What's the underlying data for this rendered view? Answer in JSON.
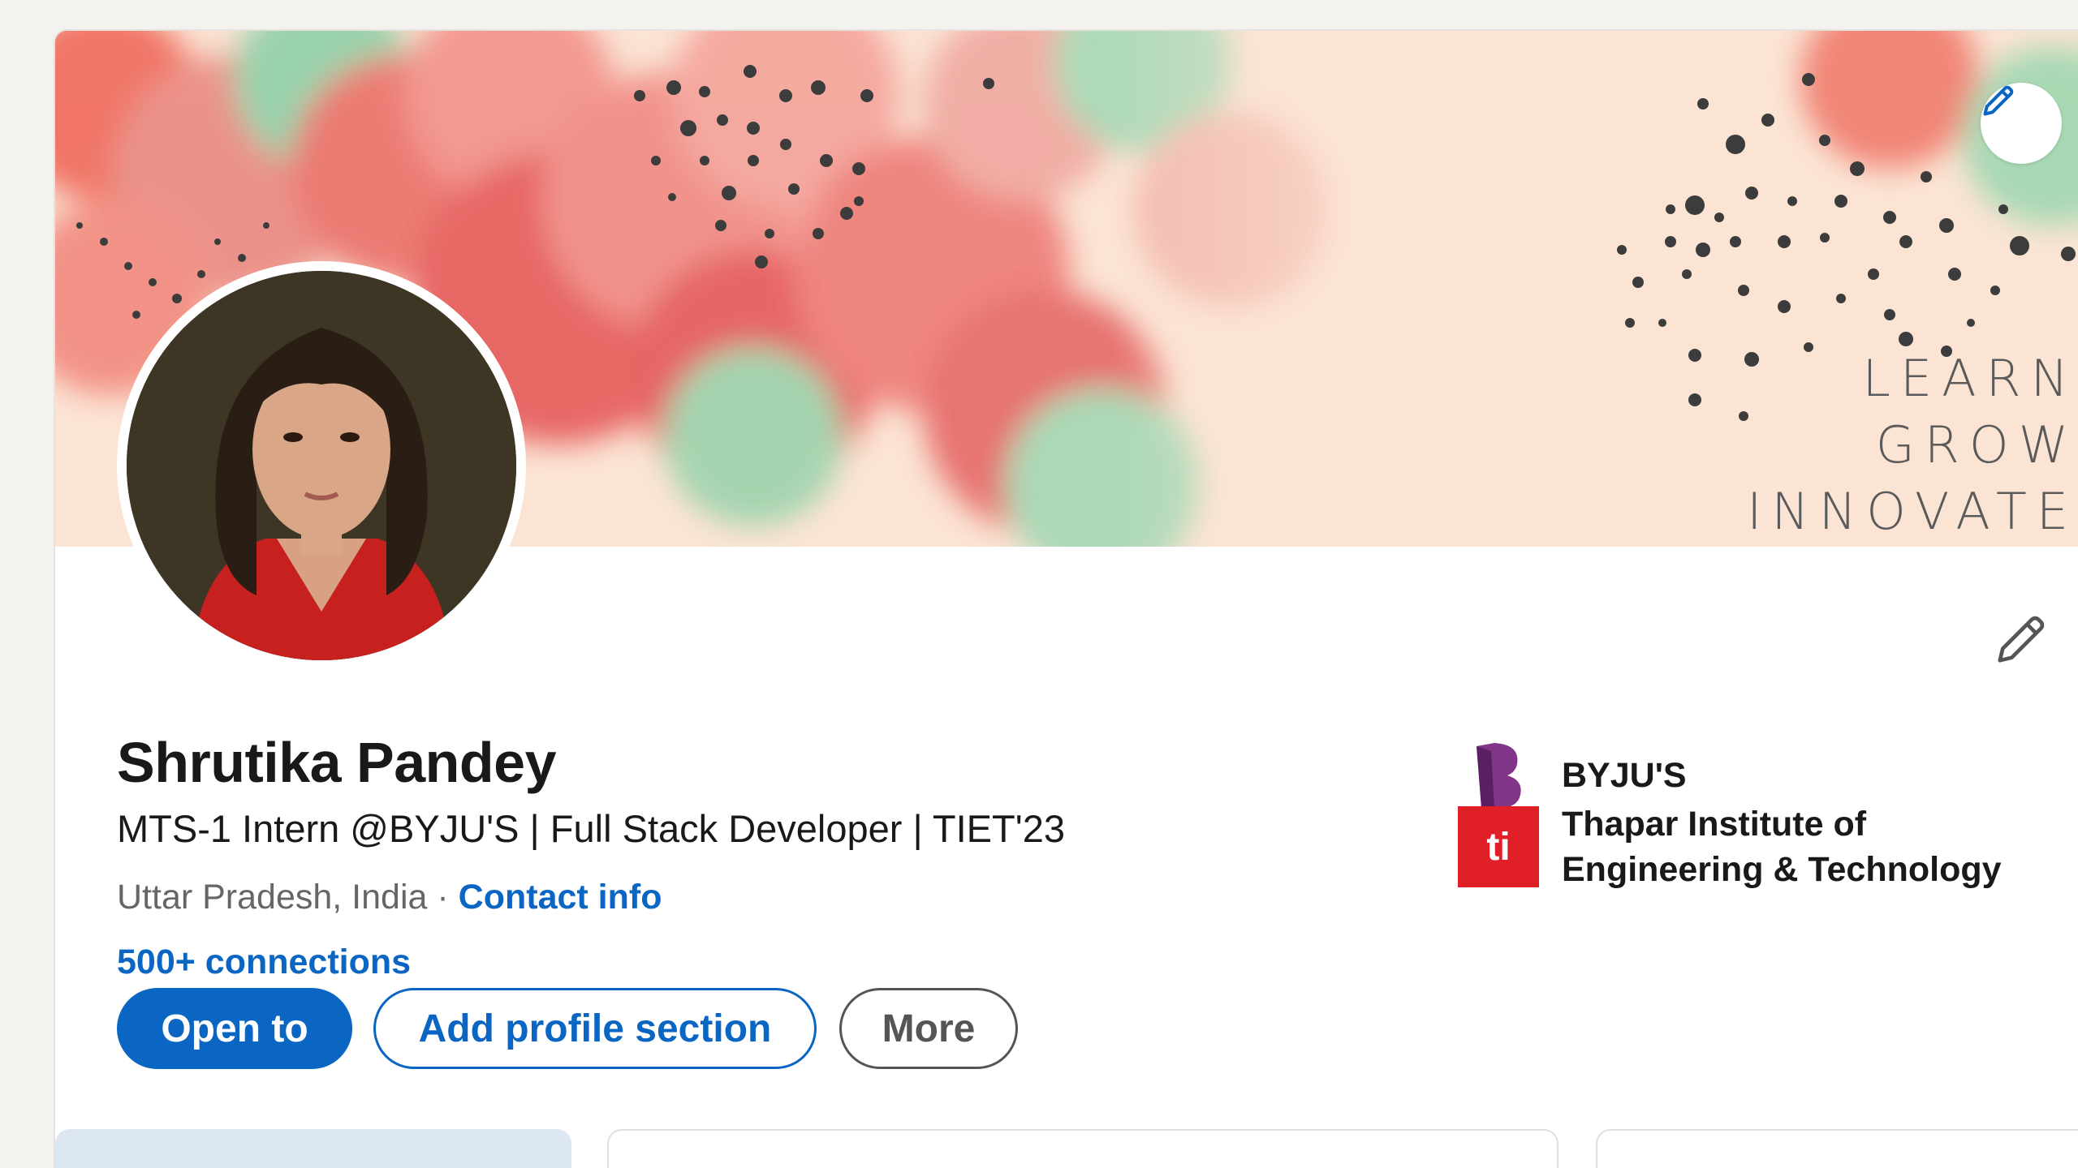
{
  "banner": {
    "lines": [
      "LEARN",
      "GROW",
      "INNOVATE"
    ],
    "edit_icon": "pencil-icon"
  },
  "profile": {
    "name": "Shrutika Pandey",
    "headline": "MTS-1 Intern @BYJU'S | Full Stack Developer | TIET'23",
    "location": "Uttar Pradesh, India",
    "separator": "·",
    "contact_info": "Contact info",
    "connections": "500+ connections",
    "edit_icon": "pencil-icon"
  },
  "buttons": {
    "open_to": "Open to",
    "add_section": "Add profile section",
    "more": "More"
  },
  "experience": [
    {
      "name": "BYJU'S",
      "logo": "byjus-logo"
    },
    {
      "name_line1": "Thapar Institute of",
      "name_line2": "Engineering & Technology",
      "logo": "ti-logo",
      "logo_text": "ti"
    }
  ],
  "colors": {
    "accent": "#0a66c2",
    "byjus": "#813588",
    "thapar": "#e01f26"
  }
}
